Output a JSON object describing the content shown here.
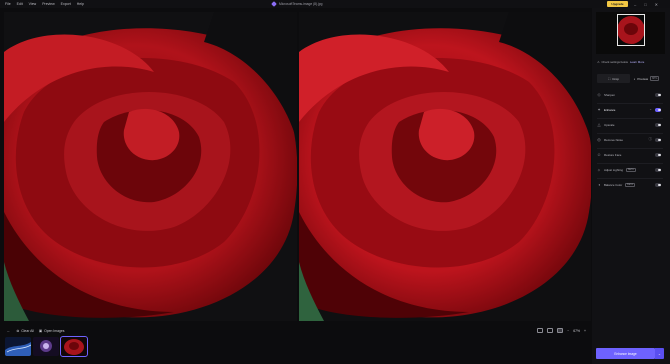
{
  "menu": [
    "File",
    "Edit",
    "View",
    "Preview",
    "Export",
    "Help"
  ],
  "window_title": "MicrosoftTeams-image (8).jpg",
  "upgrade_label": "Upgrade",
  "window_controls": [
    "minimize",
    "maximize",
    "close"
  ],
  "toolbar": {
    "back_label": "←",
    "clear_all_label": "Clear All",
    "open_images_label": "Open Images",
    "zoom_label": "67%"
  },
  "thumbnails": [
    {
      "name": "thumbnail-1"
    },
    {
      "name": "thumbnail-2"
    },
    {
      "name": "thumbnail-3",
      "selected": true
    }
  ],
  "sidebar": {
    "notice_text": "Check settings below",
    "notice_link": "Learn More",
    "modes": [
      {
        "label": "Crop",
        "active": true
      },
      {
        "label": "Preview",
        "tag": "MTG",
        "active": false
      }
    ],
    "models": [
      {
        "label": "Sharpen",
        "icon": "sharpen-icon",
        "on": false
      },
      {
        "label": "Enhance",
        "icon": "enhance-icon",
        "on": true,
        "highlight": true
      },
      {
        "label": "Upscale",
        "icon": "upscale-icon",
        "on": false
      },
      {
        "label": "Remove Noise",
        "icon": "denoise-icon",
        "on": false
      },
      {
        "label": "Restore Face",
        "icon": "face-icon",
        "on": false
      },
      {
        "label": "Adjust Lighting",
        "icon": "lighting-icon",
        "on": false,
        "tag": "BETA"
      },
      {
        "label": "Balance Color",
        "icon": "color-icon",
        "on": false,
        "tag": "BETA"
      }
    ],
    "enhance_button": "Enhance Image"
  },
  "colors": {
    "accent": "#6e62ff",
    "upgrade": "#f2c744",
    "rose_dark": "#4a0205",
    "rose_mid": "#9b0a10",
    "rose_light": "#d4232b"
  }
}
